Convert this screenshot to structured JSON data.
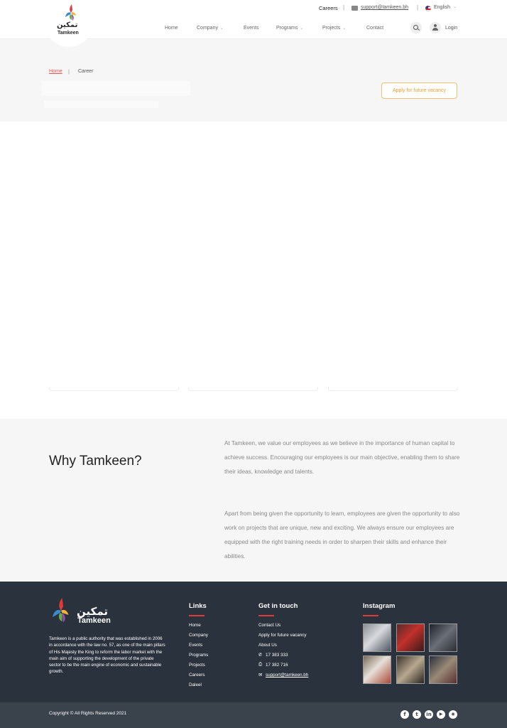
{
  "topbar": {
    "careers": "Careers",
    "email": "support@tamkeen.bh",
    "language": "English"
  },
  "logo": {
    "arabic": "تمكين",
    "english": "Tamkeen"
  },
  "nav": {
    "items": [
      {
        "label": "Home",
        "has_dropdown": false
      },
      {
        "label": "Company",
        "has_dropdown": true
      },
      {
        "label": "Events",
        "has_dropdown": false
      },
      {
        "label": "Programs",
        "has_dropdown": true
      },
      {
        "label": "Projects",
        "has_dropdown": true
      },
      {
        "label": "Contact",
        "has_dropdown": false
      }
    ],
    "login": "Login"
  },
  "breadcrumb": {
    "home": "Home",
    "separator": "|",
    "current": "Career"
  },
  "hero": {
    "apply_button": "Apply for future vacancy"
  },
  "why": {
    "title": "Why Tamkeen?",
    "paragraphs": [
      "At Tamkeen, we value our employees as we believe in the importance of human capital to achieve success. Encouraging our employees is our main objective, enabling them to share their ideas, knowledge and talents.",
      "Apart from being given the opportunity to learn, employees are given the opportunity to also work on projects that are unique, new and exciting. We always ensure our employees are equipped with the right training needs in order to sharpen their skills and enhance their abilities."
    ]
  },
  "footer": {
    "description": "Tamkeen is a public authority that was established in 2006 in accordance with the law no. 57, as one of the main pillars of His Majesty the King to reform the labor market with the main aim of supporting the development of the private sector to be the main engine of economic and sustainable growth.",
    "links_title": "Links",
    "links": [
      "Home",
      "Company",
      "Events",
      "Programs",
      "Projects",
      "Careers",
      "Daleel"
    ],
    "contact_title": "Get in touch",
    "contact_links": [
      "Contact Us",
      "Apply for future vacancy",
      "About Us"
    ],
    "phone": "17 383 333",
    "fax": "17 382 716",
    "email": "support@tamkeen.bh",
    "instagram_title": "Instagram",
    "copyright": "Copyright © All Rights Reserved 2021",
    "social": [
      "facebook-icon",
      "twitter-icon",
      "linkedin-icon",
      "youtube-icon",
      "instagram-icon"
    ]
  },
  "colors": {
    "accent_red": "#e05555",
    "apply_orange": "#e8a030",
    "footer_bg": "#2a323d",
    "footer_bottom_bg": "#3a424c"
  }
}
